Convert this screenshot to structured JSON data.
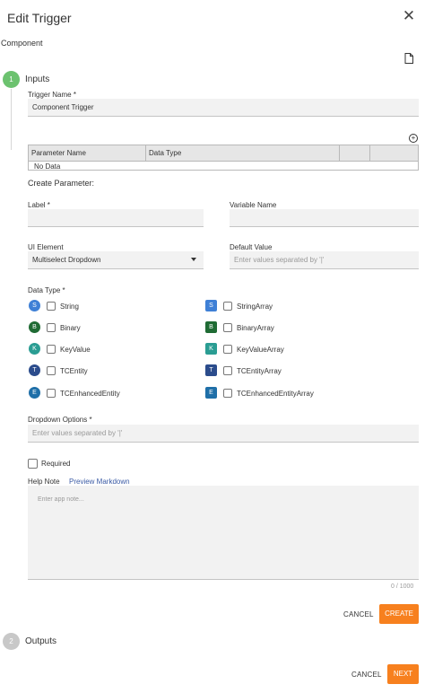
{
  "header": {
    "title": "Edit Trigger",
    "close_glyph": "✕"
  },
  "section_label": "Component",
  "steps": [
    {
      "number": "1",
      "label": "Inputs",
      "color": "#6cc26f"
    },
    {
      "number": "2",
      "label": "Outputs",
      "color": "#c8c8c8"
    }
  ],
  "trigger_name": {
    "label": "Trigger Name *",
    "value": "Component Trigger"
  },
  "add_glyph": "+",
  "params_table": {
    "headers": [
      "Parameter Name",
      "Data Type",
      "",
      ""
    ],
    "empty_text": "No Data"
  },
  "create_parameter": {
    "title": "Create Parameter:",
    "label_field": {
      "label": "Label *",
      "value": ""
    },
    "variable_name": {
      "label": "Variable Name",
      "value": ""
    },
    "ui_element": {
      "label": "UI Element",
      "value": "Multiselect Dropdown"
    },
    "default_value": {
      "label": "Default Value",
      "placeholder": "Enter values separated by '|'"
    },
    "data_type": {
      "label": "Data Type *",
      "left": [
        {
          "badge": "S",
          "name": "String",
          "color": "#3f80d6"
        },
        {
          "badge": "B",
          "name": "Binary",
          "color": "#1f6b34"
        },
        {
          "badge": "K",
          "name": "KeyValue",
          "color": "#2a9d93"
        },
        {
          "badge": "T",
          "name": "TCEntity",
          "color": "#2b4c8c"
        },
        {
          "badge": "E",
          "name": "TCEnhancedEntity",
          "color": "#1f6fa8"
        }
      ],
      "right": [
        {
          "badge": "S",
          "name": "StringArray",
          "color": "#3f80d6"
        },
        {
          "badge": "B",
          "name": "BinaryArray",
          "color": "#1f6b34"
        },
        {
          "badge": "K",
          "name": "KeyValueArray",
          "color": "#2a9d93"
        },
        {
          "badge": "T",
          "name": "TCEntityArray",
          "color": "#2b4c8c"
        },
        {
          "badge": "E",
          "name": "TCEnhancedEntityArray",
          "color": "#1f6fa8"
        }
      ]
    },
    "dropdown_options": {
      "label": "Dropdown Options *",
      "placeholder": "Enter values separated by '|'"
    },
    "required": {
      "label": "Required",
      "checked": false
    },
    "help_note": {
      "label": "Help Note",
      "preview_link": "Preview Markdown",
      "placeholder": "Enter app note...",
      "counter": "0 / 1000"
    },
    "cancel_label": "CANCEL",
    "create_label": "CREATE"
  },
  "footer": {
    "cancel_label": "CANCEL",
    "next_label": "NEXT"
  },
  "colors": {
    "accent": "#f7801e",
    "link": "#3b5ba5",
    "step_active": "#6cc26f"
  }
}
